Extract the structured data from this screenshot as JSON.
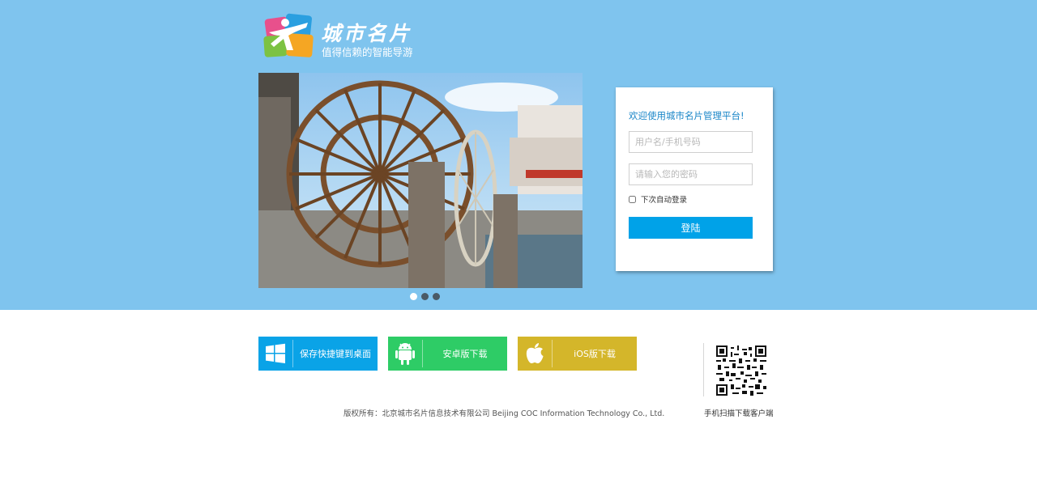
{
  "logo": {
    "title": "城市名片",
    "subtitle": "值得信赖的智能导游"
  },
  "slider": {
    "dots": [
      {
        "name": "slide-dot-1",
        "active": true
      },
      {
        "name": "slide-dot-2",
        "active": false
      },
      {
        "name": "slide-dot-3",
        "active": false
      }
    ]
  },
  "login": {
    "title": "欢迎使用城市名片管理平台!",
    "username_placeholder": "用户名/手机号码",
    "password_placeholder": "请输入您的密码",
    "remember_label": "下次自动登录",
    "submit_label": "登陆"
  },
  "downloads": {
    "windows_label": "保存快捷键到桌面",
    "android_label": "安卓版下载",
    "ios_label": "iOS版下载"
  },
  "footer": {
    "copyright": "版权所有：北京城市名片信息技术有限公司 Beijing COC Information Technology Co., Ltd.",
    "qr_caption": "手机扫描下载客户端"
  },
  "colors": {
    "top_band": "#7fc4ee",
    "login_button": "#00a2e8",
    "windows": "#0aa3e7",
    "android": "#2ecc66",
    "ios": "#d4b62a",
    "login_title": "#1a86c8"
  },
  "icons": [
    "logo-mark-icon",
    "windows-icon",
    "android-icon",
    "apple-icon",
    "qr-code-icon"
  ]
}
